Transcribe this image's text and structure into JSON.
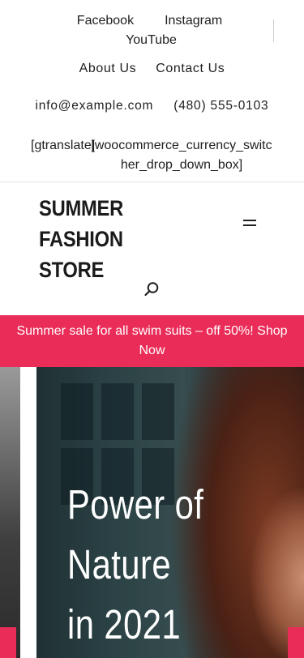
{
  "social": {
    "facebook": "Facebook",
    "instagram": "Instagram",
    "youtube": "YouTube"
  },
  "pages": {
    "about": "About Us",
    "contact": "Contact Us"
  },
  "contact": {
    "email": "info@example.com",
    "phone": "(480) 555-0103"
  },
  "shortcodes": {
    "translate": "[gtranslate]",
    "currency": "[woocommerce_currency_switcher_drop_down_box]"
  },
  "header": {
    "logo": "SUMMER FASHION STORE",
    "menu_icon": "hamburger-menu-icon",
    "search_icon": "search-icon"
  },
  "promo": {
    "text": "Summer sale for all swim suits – off 50%! Shop Now"
  },
  "hero": {
    "title_line1": "Power of",
    "title_line2": "Nature",
    "title_line3": "in 2021"
  },
  "colors": {
    "accent": "#ea2c58",
    "text": "#1f1f1f",
    "background": "#ffffff"
  }
}
